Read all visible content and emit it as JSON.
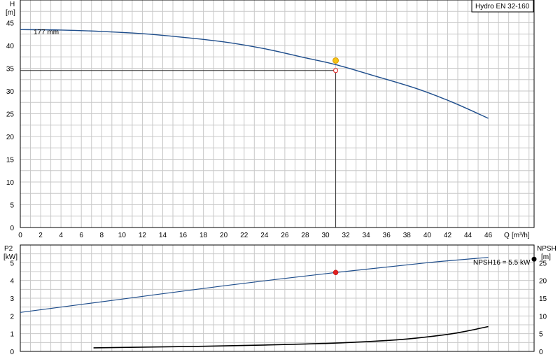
{
  "model_label": "Hydro EN 32-160",
  "colors": {
    "curve": "#1f4e8c",
    "power_curve": "#1f4e8c",
    "npsh_curve": "#000000",
    "duty_point_top": "#f5c518",
    "duty_point_bottom": "#e02020",
    "grid": "#c8c8c8",
    "axis": "#000000"
  },
  "chart_data": [
    {
      "type": "line",
      "title": "",
      "ylabel": "H",
      "yunit": "[m]",
      "xlabel": "Q",
      "xunit": "[m³/h]",
      "xlim": [
        0,
        50.5
      ],
      "ylim": [
        0,
        50
      ],
      "xticks": [
        0,
        2,
        4,
        6,
        8,
        10,
        12,
        14,
        16,
        18,
        20,
        22,
        24,
        26,
        28,
        30,
        32,
        34,
        36,
        38,
        40,
        42,
        44,
        46
      ],
      "yticks": [
        0,
        5,
        10,
        15,
        20,
        25,
        30,
        35,
        40,
        45
      ],
      "grid": true,
      "series": [
        {
          "name": "177 mm",
          "x": [
            0,
            4,
            8,
            12,
            16,
            20,
            24,
            28,
            31,
            35,
            39,
            42.5,
            46
          ],
          "y": [
            43.5,
            43.4,
            43.1,
            42.6,
            41.8,
            40.8,
            39.3,
            37.3,
            35.8,
            33.2,
            30.5,
            27.5,
            24
          ]
        }
      ],
      "duty_point": {
        "x": 31,
        "y": 36.7
      },
      "required_point": {
        "x": 31,
        "y": 34.5
      }
    },
    {
      "type": "line",
      "title": "",
      "ylabel": "P2",
      "yunit": "[kW]",
      "ylabel_right": "NPSH",
      "yunit_right": "[m]",
      "xlim": [
        0,
        50.5
      ],
      "ylim": [
        0,
        6
      ],
      "ylim_right": [
        0,
        30
      ],
      "yticks": [
        0,
        1,
        2,
        3,
        4,
        5
      ],
      "yticks_right": [
        0,
        5,
        10,
        15,
        20,
        25
      ],
      "grid": true,
      "annotation": "NPSH16 = 5.5 kW",
      "series": [
        {
          "name": "P2",
          "axis": "left",
          "x": [
            0,
            10,
            20,
            31,
            40,
            46
          ],
          "y": [
            2.2,
            2.95,
            3.7,
            4.45,
            5.0,
            5.3
          ]
        },
        {
          "name": "NPSH",
          "axis": "right",
          "x": [
            7.2,
            12,
            18,
            24,
            28,
            31,
            35,
            38,
            42,
            44,
            46
          ],
          "y": [
            1.0,
            1.2,
            1.45,
            1.8,
            2.1,
            2.35,
            2.9,
            3.5,
            4.8,
            5.8,
            7.0
          ]
        }
      ],
      "duty_point": {
        "x": 31,
        "y": 4.45
      }
    }
  ]
}
